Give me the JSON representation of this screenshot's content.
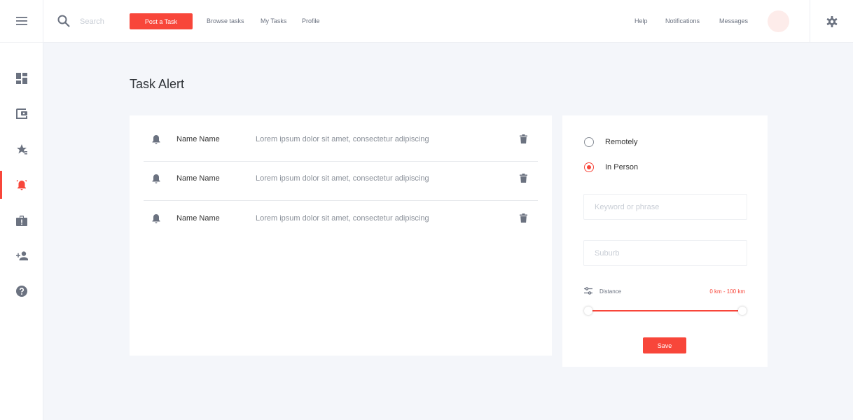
{
  "colors": {
    "accent": "#f8463a",
    "icon_gray": "#6b7280",
    "background": "#f4f6fa"
  },
  "rail": {
    "menu_icon": "hamburger-icon",
    "items": [
      {
        "icon": "dashboard-icon",
        "active": false
      },
      {
        "icon": "wallet-icon",
        "active": false
      },
      {
        "icon": "star-list-icon",
        "active": false
      },
      {
        "icon": "bell-alert-icon",
        "active": true
      },
      {
        "icon": "briefcase-alert-icon",
        "active": false
      },
      {
        "icon": "add-person-icon",
        "active": false
      },
      {
        "icon": "help-icon",
        "active": false
      }
    ]
  },
  "topbar": {
    "search_placeholder": "Search",
    "post_task_label": "Post a Task",
    "links": [
      "Browse tasks",
      "My Tasks",
      "Profile"
    ],
    "right_links": [
      "Help",
      "Notifications",
      "Messages"
    ]
  },
  "page": {
    "title": "Task Alert"
  },
  "alerts": [
    {
      "name": "Name Name",
      "description": "Lorem ipsum dolor sit amet, consectetur adipiscing"
    },
    {
      "name": "Name Name",
      "description": "Lorem ipsum dolor sit amet, consectetur adipiscing"
    },
    {
      "name": "Name Name",
      "description": "Lorem ipsum dolor sit amet, consectetur adipiscing"
    }
  ],
  "filter": {
    "options": [
      {
        "label": "Remotely",
        "checked": false
      },
      {
        "label": "In Person",
        "checked": true
      }
    ],
    "keyword_placeholder": "Keyword or phrase",
    "suburb_placeholder": "Suburb",
    "distance_label": "Distance",
    "distance_range": "0 km - 100 km",
    "save_label": "Save"
  }
}
